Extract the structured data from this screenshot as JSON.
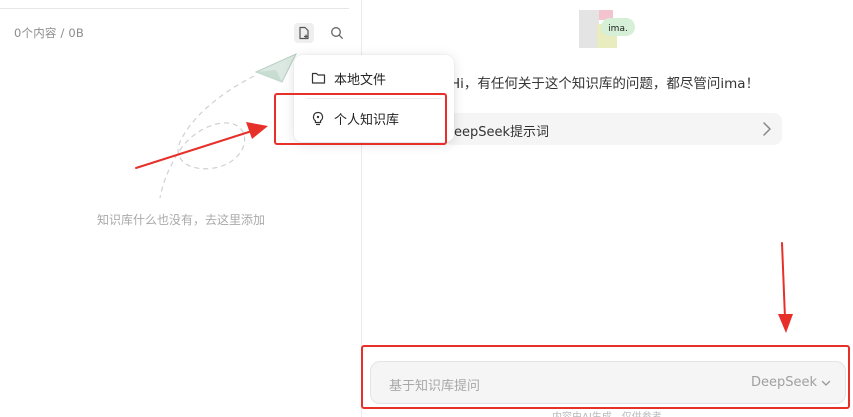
{
  "left_panel": {
    "count_text": "0个内容 / 0B",
    "empty_text": "知识库什么也没有，去这里添加"
  },
  "popup": {
    "items": [
      {
        "label": "本地文件",
        "icon": "folder-icon"
      },
      {
        "label": "个人知识库",
        "icon": "bulb-icon"
      }
    ]
  },
  "right_panel": {
    "avatar_label": "ima.",
    "greeting": "Hi，有任何关于这个知识库的问题，都尽管问ima！",
    "prompt_row_label": "DeepSeek提示词",
    "input_placeholder": "基于知识库提问",
    "model": "DeepSeek",
    "footer_note": "内容由AI生成，仅供参考"
  },
  "colors": {
    "annotation": "#e8302a",
    "muted_text": "#8c8c8c"
  }
}
